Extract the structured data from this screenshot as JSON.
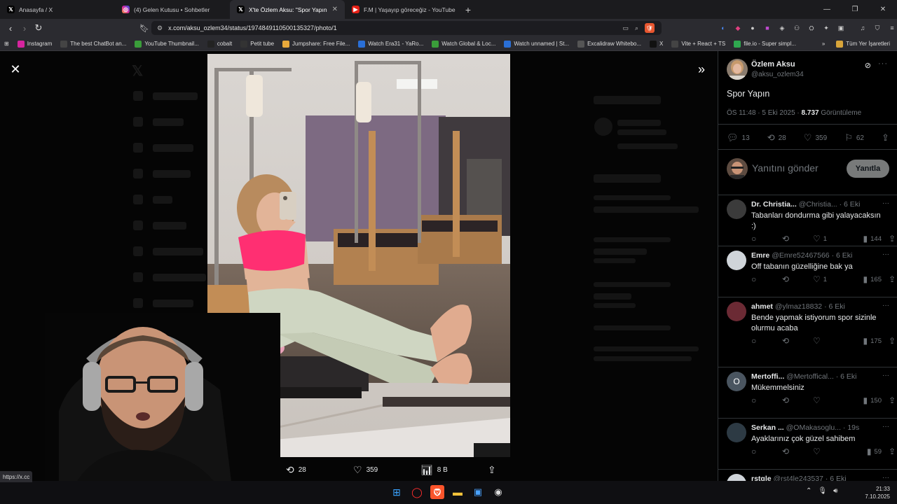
{
  "tabs": [
    {
      "title": "Anasayfa / X",
      "icon": "x-logo-icon"
    },
    {
      "title": "(4) Gelen Kutusu • Sohbetler",
      "icon": "instagram-icon"
    },
    {
      "title": "X'te Özlem Aksu: \"Spor Yapın htt",
      "icon": "x-logo-icon",
      "active": true
    },
    {
      "title": "F.M | Yaşayıp göreceğiz - YouTube",
      "icon": "youtube-icon"
    }
  ],
  "address": {
    "url": "x.com/aksu_ozlem34/status/1974849110500135327/photo/1"
  },
  "bookmarks": [
    {
      "label": "Instagram",
      "color": "#d6249f"
    },
    {
      "label": "The best ChatBot an...",
      "color": "#444"
    },
    {
      "label": "YouTube Thumbnail...",
      "color": "#3a9d3a"
    },
    {
      "label": "cobalt",
      "color": "#222"
    },
    {
      "label": "Petit tube",
      "color": "#333"
    },
    {
      "label": "Jumpshare: Free File...",
      "color": "#e8a93b"
    },
    {
      "label": "Watch Era31 - YaRo...",
      "color": "#2a6fd6"
    },
    {
      "label": "Watch Global & Loc...",
      "color": "#3a9d3a"
    },
    {
      "label": "Watch unnamed | St...",
      "color": "#2a6fd6"
    },
    {
      "label": "Excalidraw Whitebo...",
      "color": "#555"
    },
    {
      "label": "X",
      "color": "#111"
    },
    {
      "label": "Vite + React + TS",
      "color": "#444"
    },
    {
      "label": "file.io - Super simpl...",
      "color": "#2fa84f"
    }
  ],
  "bookmarks_all": "Tüm Yer İşaretleri",
  "photo_actions": {
    "retweets": "28",
    "likes": "359",
    "views": "8 B"
  },
  "post": {
    "name": "Özlem Aksu",
    "handle": "@aksu_ozlem34",
    "text": "Spor Yapın",
    "time": "ÖS 11:48 · 5 Eki 2025 · ",
    "views_count": "8.737",
    "views_label": " Görüntüleme",
    "replies": "13",
    "retweets": "28",
    "likes": "359",
    "bookmarks": "62"
  },
  "reply_box": {
    "placeholder": "Yanıtını gönder",
    "button": "Yanıtla"
  },
  "replies": [
    {
      "name": "Dr. Christia...",
      "handle": "@Christia...",
      "time": "· 6 Eki",
      "text": "Tabanları dondurma gibi yalayacaksın :)",
      "likes": "1",
      "views": "144"
    },
    {
      "name": "Emre",
      "handle": "@Emre52467566",
      "time": "· 6 Eki",
      "text": "Off tabanın güzelliğine bak ya",
      "likes": "1",
      "views": "165"
    },
    {
      "name": "ahmet",
      "handle": "@ylmaz18832",
      "time": "· 6 Eki",
      "text": "Bende yapmak istiyorum spor sizinle olurmu acaba",
      "likes": "",
      "views": "175"
    },
    {
      "name": "Mertoffi...",
      "handle": "@Mertoffical...",
      "time": "· 6 Eki",
      "text": "Mükemmelsiniz",
      "likes": "",
      "views": "150",
      "initial": "O"
    },
    {
      "name": "Serkan ...",
      "handle": "@OMakasoglu...",
      "time": "· 19s",
      "text": "Ayaklarınız çok güzel sahibem",
      "likes": "",
      "views": "59"
    },
    {
      "name": "rstgle",
      "handle": "@rst4le243537",
      "time": "· 6 Eki",
      "text": "",
      "likes": "",
      "views": ""
    }
  ],
  "status_url": "https://x.cc",
  "clock": {
    "time": "21:33",
    "date": "7.10.2025"
  }
}
